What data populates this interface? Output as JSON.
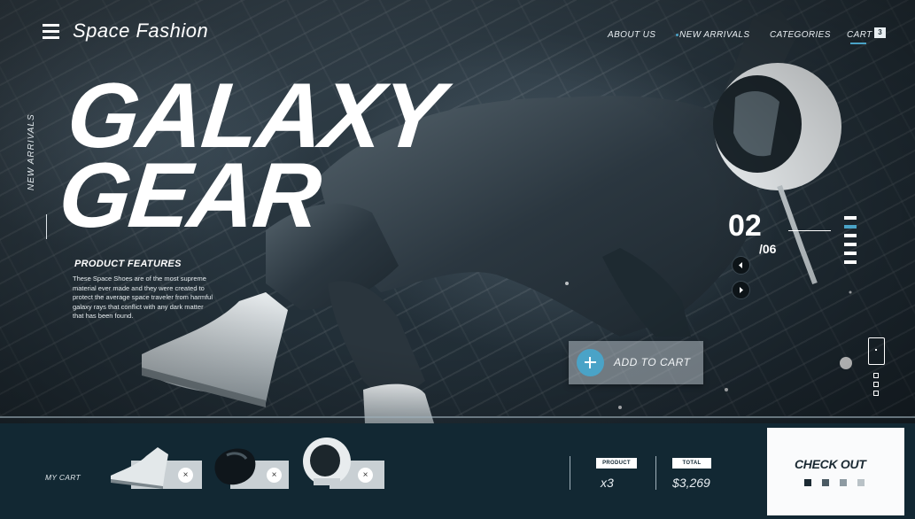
{
  "brand": "Space Fashion",
  "nav": {
    "about": "ABOUT US",
    "new_arrivals": "NEW ARRIVALS",
    "categories": "CATEGORIES",
    "cart": "CART",
    "cart_count": "3"
  },
  "hero": {
    "line1": "GALAXY",
    "line2": "GEAR",
    "side_label": "NEW ARRIVALS",
    "features_title": "PRODUCT FEATURES",
    "features_text": "These Space Shoes are of the most supreme material ever made and they were created to protect the average space traveler from harmful galaxy rays that conflict with any dark matter that has been found."
  },
  "slider": {
    "current": "02",
    "total": "/06",
    "active_index": 1,
    "count": 6
  },
  "add_to_cart": "ADD TO CART",
  "cart": {
    "label": "MY CART",
    "items": [
      {
        "name": "boot-item",
        "remove": "×"
      },
      {
        "name": "gloves-item",
        "remove": "×"
      },
      {
        "name": "helmet-item",
        "remove": "×"
      }
    ],
    "product_label": "PRODUCT",
    "product_value": "x3",
    "total_label": "TOTAL",
    "total_value": "$3,269"
  },
  "checkout": {
    "label": "CHECK OUT"
  },
  "colors": {
    "accent": "#4aa3c7",
    "bar": "#122833",
    "checkout_bg": "#fafbfc"
  },
  "icons": [
    "menu-icon",
    "plus-icon",
    "arrow-left-icon",
    "arrow-right-icon",
    "phone-icon",
    "close-icon"
  ]
}
